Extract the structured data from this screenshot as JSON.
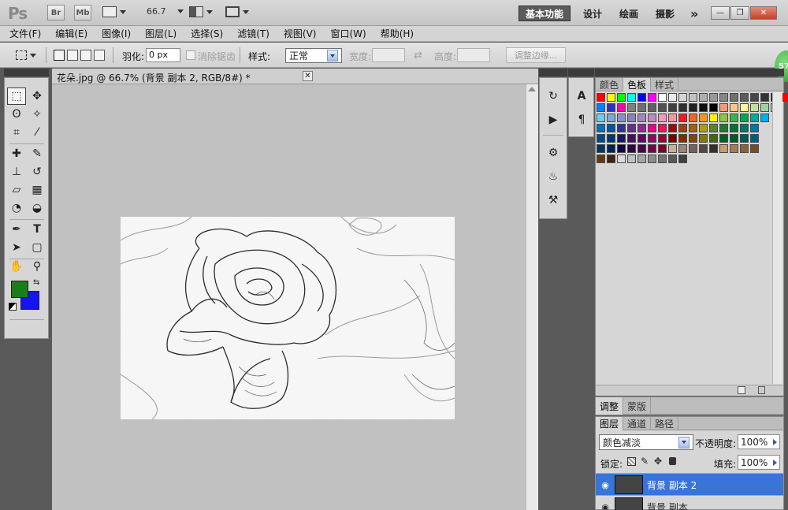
{
  "app": {
    "logo": "Ps",
    "bridge_label": "Br",
    "minibridge_label": "Mb",
    "zoom_value": "66.7",
    "workspaces": [
      {
        "label": "基本功能",
        "active": true
      },
      {
        "label": "设计",
        "active": false
      },
      {
        "label": "绘画",
        "active": false
      },
      {
        "label": "摄影",
        "active": false
      }
    ],
    "more_label": "»",
    "minimize_label": "—",
    "restore_label": "❐",
    "close_label": "✕"
  },
  "menu": [
    "文件(F)",
    "编辑(E)",
    "图像(I)",
    "图层(L)",
    "选择(S)",
    "滤镜(T)",
    "视图(V)",
    "窗口(W)",
    "帮助(H)"
  ],
  "options": {
    "feather_label": "羽化:",
    "feather_value": "0 px",
    "antialias_label": "消除锯齿",
    "style_label": "样式:",
    "style_value": "正常",
    "width_label": "宽度:",
    "height_label": "高度:",
    "swap_icon": "swap-icon",
    "refine_label": "调整边缘..."
  },
  "badge": "57",
  "document": {
    "tab_title": "花朵.jpg @ 66.7% (背景 副本 2, RGB/8#) *",
    "close_label": "✕"
  },
  "tools": [
    {
      "name": "rectangular-marquee-icon",
      "glyph": "⬚"
    },
    {
      "name": "move-tool-icon",
      "glyph": "✥"
    },
    {
      "name": "lasso-tool-icon",
      "glyph": "ʘ"
    },
    {
      "name": "magic-wand-icon",
      "glyph": "✧"
    },
    {
      "name": "crop-tool-icon",
      "glyph": "⌗"
    },
    {
      "name": "eyedropper-icon",
      "glyph": "⁄"
    },
    {
      "name": "healing-brush-icon",
      "glyph": "✚"
    },
    {
      "name": "brush-tool-icon",
      "glyph": "✎"
    },
    {
      "name": "clone-stamp-icon",
      "glyph": "⊥"
    },
    {
      "name": "history-brush-icon",
      "glyph": "↺"
    },
    {
      "name": "eraser-tool-icon",
      "glyph": "▱"
    },
    {
      "name": "gradient-tool-icon",
      "glyph": "▦"
    },
    {
      "name": "blur-tool-icon",
      "glyph": "◔"
    },
    {
      "name": "dodge-tool-icon",
      "glyph": "◒"
    },
    {
      "name": "pen-tool-icon",
      "glyph": "✒"
    },
    {
      "name": "type-tool-icon",
      "glyph": "T"
    },
    {
      "name": "path-selection-icon",
      "glyph": "➤"
    },
    {
      "name": "shape-tool-icon",
      "glyph": "▢"
    },
    {
      "name": "hand-tool-icon",
      "glyph": "✋"
    },
    {
      "name": "zoom-tool-icon",
      "glyph": "⚲"
    }
  ],
  "colors": {
    "foreground": "#1a7d1a",
    "background": "#1414f0"
  },
  "strip1": [
    {
      "name": "history-panel-icon",
      "glyph": "↻"
    },
    {
      "name": "actions-panel-icon",
      "glyph": "▶"
    },
    {
      "name": "brushes-panel-icon",
      "glyph": "⚙"
    },
    {
      "name": "clone-source-icon",
      "glyph": "♨"
    },
    {
      "name": "tool-presets-icon",
      "glyph": "⚒"
    }
  ],
  "strip2": [
    {
      "name": "character-panel-icon",
      "glyph": "A"
    },
    {
      "name": "paragraph-panel-icon",
      "glyph": "¶"
    }
  ],
  "swatch_panel": {
    "tabs": [
      {
        "label": "颜色",
        "active": false
      },
      {
        "label": "色板",
        "active": true
      },
      {
        "label": "样式",
        "active": false
      }
    ],
    "rows": [
      [
        "#ff0000",
        "#ffff00",
        "#00ff00",
        "#00ffff",
        "#0000ff",
        "#ff00ff",
        "#ffffff",
        "#ebebeb",
        "#d6d6d6",
        "#c2c2c2",
        "#adadad",
        "#999999",
        "#858585",
        "#707070",
        "#5c5c5c",
        "#474747",
        "#333333",
        "#1f1f1f",
        "#ff0000",
        "#ffff00",
        "#00ff00"
      ],
      [
        "#0080ff",
        "#3030c0",
        "#ff00aa",
        "#808080",
        "#707070",
        "#606060",
        "#505050",
        "#404040",
        "#303030",
        "#202020",
        "#101010",
        "#000000",
        "#f29b76",
        "#fdc689",
        "#fff799",
        "#c4df9b",
        "#a3d39c",
        "#7bcdc8"
      ],
      [
        "#6dcff6",
        "#7da7d9",
        "#8493ca",
        "#8781bd",
        "#a286bd",
        "#bc8cbf",
        "#f49ac1",
        "#f5989d",
        "#ed1c24",
        "#f26522",
        "#f7941d",
        "#fff200",
        "#8dc63f",
        "#39b54a",
        "#00a651",
        "#00a99d",
        "#00aeef"
      ],
      [
        "#0072bc",
        "#0054a6",
        "#2e3192",
        "#662d91",
        "#92278f",
        "#ec008c",
        "#ed145b",
        "#9e0b0f",
        "#a0410d",
        "#a36209",
        "#aba000",
        "#598527",
        "#197b30",
        "#007236",
        "#00746b",
        "#0076a3"
      ],
      [
        "#004a80",
        "#003471",
        "#1b1464",
        "#440e62",
        "#630460",
        "#9e005d",
        "#9e0039",
        "#790000",
        "#7b2e00",
        "#7d4900",
        "#827b00",
        "#406618",
        "#005e20",
        "#005826",
        "#005952",
        "#005b7f"
      ],
      [
        "#003663",
        "#002157",
        "#0d004c",
        "#32004b",
        "#4b0049",
        "#7b0046",
        "#7a0026",
        "#c7b299",
        "#998675",
        "#736357",
        "#534741",
        "#362f2d",
        "#c69c6d",
        "#a67c52",
        "#8c6239",
        "#754c24"
      ],
      [
        "#603913",
        "#3c2415",
        "#d9d9d9",
        "#bfbfbf",
        "#a6a6a6",
        "#8c8c8c",
        "#737373",
        "#595959",
        "#404040"
      ]
    ]
  },
  "adjust_panel": {
    "tabs": [
      {
        "label": "调整",
        "active": true
      },
      {
        "label": "蒙版",
        "active": false
      }
    ]
  },
  "layers_panel": {
    "tabs": [
      {
        "label": "图层",
        "active": true
      },
      {
        "label": "通道",
        "active": false
      },
      {
        "label": "路径",
        "active": false
      }
    ],
    "blend_mode": "颜色减淡",
    "opacity_label": "不透明度:",
    "opacity_value": "100%",
    "lock_label": "锁定:",
    "fill_label": "填充:",
    "fill_value": "100%",
    "layers": [
      {
        "name": "背景 副本 2",
        "selected": true
      },
      {
        "name": "背景 副本",
        "selected": false
      }
    ]
  }
}
